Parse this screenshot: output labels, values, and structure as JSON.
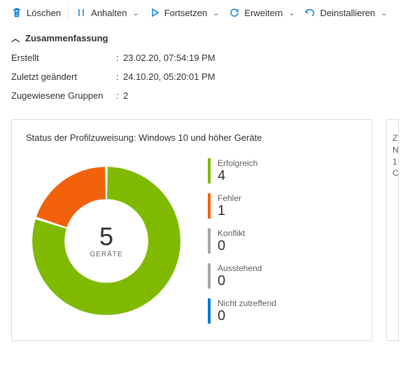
{
  "toolbar": {
    "delete": "Löschen",
    "pause": "Anhalten",
    "resume": "Fortsetzen",
    "extend": "Erweitern",
    "uninstall": "Deinstallieren"
  },
  "summary": {
    "title": "Zusammenfassung",
    "rows": [
      {
        "label": "Erstellt",
        "value": "23.02.20, 07:54:19 PM"
      },
      {
        "label": "Zuletzt geändert",
        "value": "24.10.20, 05:20:01 PM"
      },
      {
        "label": "Zugewiesene Gruppen",
        "value": "2"
      }
    ]
  },
  "card": {
    "title": "Status der Profilzuweisung: Windows 10 und höher Geräte",
    "center_value": "5",
    "center_label": "GERÄTE",
    "legend": [
      {
        "label": "Erfolgreich",
        "value": "4",
        "color": "#7fba00"
      },
      {
        "label": "Fehler",
        "value": "1",
        "color": "#f2610c"
      },
      {
        "label": "Konflikt",
        "value": "0",
        "color": "#a6a6a6"
      },
      {
        "label": "Ausstehend",
        "value": "0",
        "color": "#a6a6a6"
      },
      {
        "label": "Nicht zutreffend",
        "value": "0",
        "color": "#0078d4"
      }
    ]
  },
  "side_card": {
    "lines": [
      "Z",
      "N",
      "1",
      "C"
    ]
  },
  "chart_data": {
    "type": "pie",
    "title": "Status der Profilzuweisung: Windows 10 und höher Geräte",
    "categories": [
      "Erfolgreich",
      "Fehler",
      "Konflikt",
      "Ausstehend",
      "Nicht zutreffend"
    ],
    "values": [
      4,
      1,
      0,
      0,
      0
    ],
    "colors": [
      "#7fba00",
      "#f2610c",
      "#a6a6a6",
      "#a6a6a6",
      "#0078d4"
    ],
    "total_label": "GERÄTE",
    "total_value": 5
  }
}
